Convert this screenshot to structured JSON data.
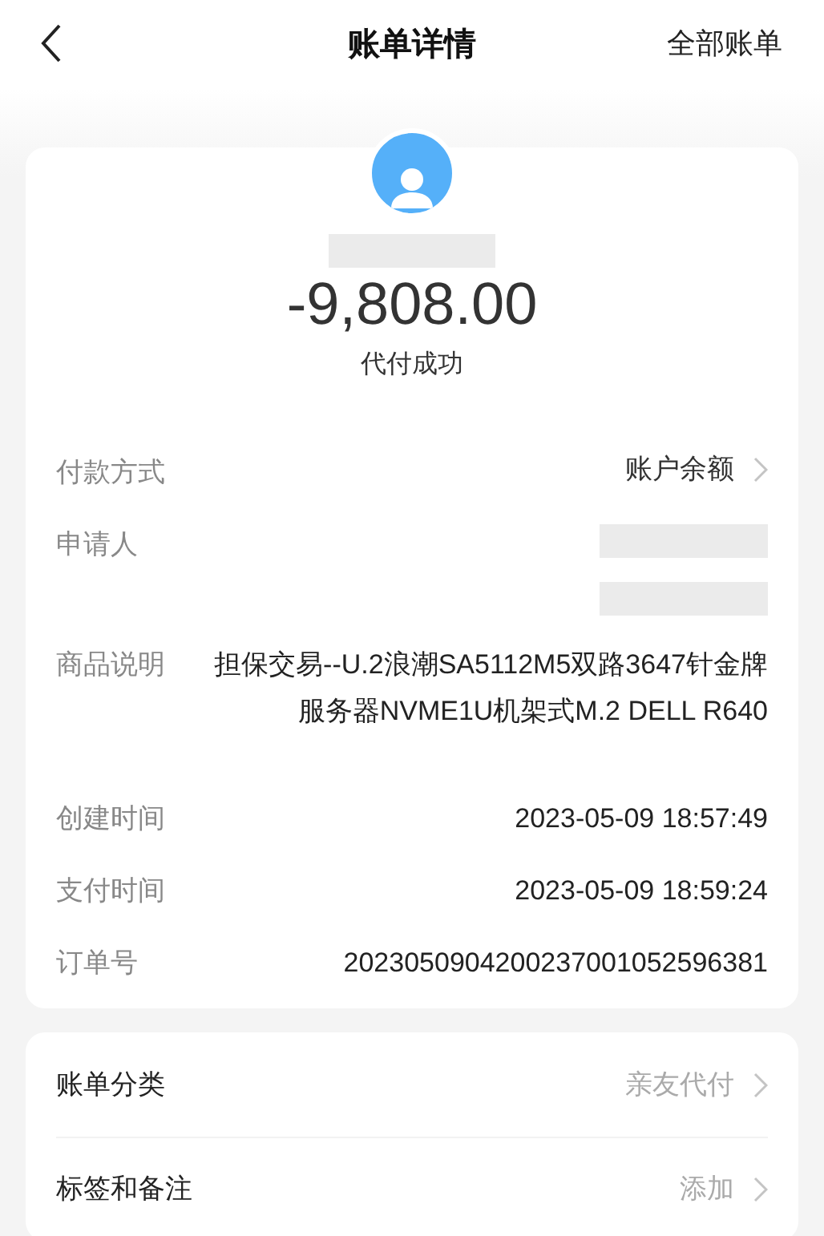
{
  "header": {
    "title": "账单详情",
    "action": "全部账单"
  },
  "summary": {
    "payee_redacted": true,
    "amount": "-9,808.00",
    "status": "代付成功"
  },
  "details": [
    {
      "kind": "link",
      "label": "付款方式",
      "value": "账户余额"
    },
    {
      "kind": "redacted",
      "label": "申请人"
    },
    {
      "kind": "text",
      "label": "商品说明",
      "value": "担保交易--U.2浪潮SA5112M5双路3647针金牌服务器NVME1U机架式M.2 DELL R640"
    },
    {
      "kind": "text",
      "label": "创建时间",
      "value": "2023-05-09 18:57:49"
    },
    {
      "kind": "text",
      "label": "支付时间",
      "value": "2023-05-09 18:59:24"
    },
    {
      "kind": "text",
      "label": "订单号",
      "value": "2023050904200237001052596381"
    }
  ],
  "extras": [
    {
      "label": "账单分类",
      "value": "亲友代付"
    },
    {
      "label": "标签和备注",
      "value": "添加"
    }
  ]
}
